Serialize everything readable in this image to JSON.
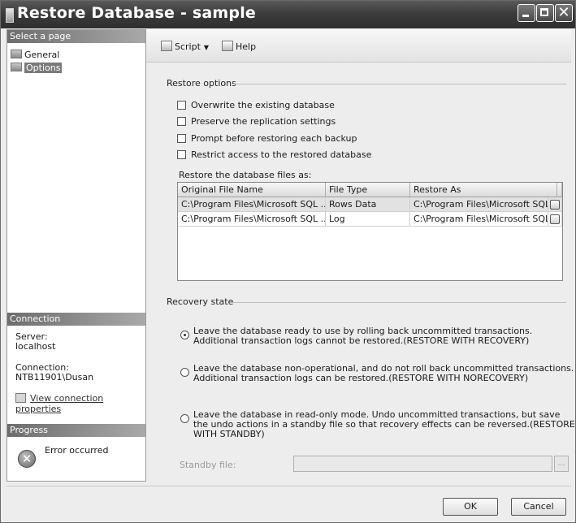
{
  "window": {
    "title": "Restore Database - sample"
  },
  "left": {
    "select_page_header": "Select a page",
    "pages": [
      {
        "label": "General",
        "selected": false
      },
      {
        "label": "Options",
        "selected": true
      }
    ],
    "connection_header": "Connection",
    "server_label": "Server:",
    "server_value": "localhost",
    "connection_label": "Connection:",
    "connection_value": "NTB11901\\Dusan",
    "view_props_link": "View connection properties",
    "progress_header": "Progress",
    "progress_status": "Error occurred",
    "error_icon_glyph": "✕"
  },
  "toolbar": {
    "script_label": "Script",
    "script_dropdown": "▼",
    "help_label": "Help"
  },
  "restore_options": {
    "title": "Restore options",
    "checkboxes": [
      {
        "label": "Overwrite the existing database",
        "checked": false
      },
      {
        "label": "Preserve the replication settings",
        "checked": false
      },
      {
        "label": "Prompt before restoring each backup",
        "checked": false
      },
      {
        "label": "Restrict access to the restored database",
        "checked": false
      }
    ],
    "files_label": "Restore the database files as:",
    "columns": [
      "Original File Name",
      "File Type",
      "Restore As"
    ],
    "rows": [
      {
        "original": "C:\\Program Files\\Microsoft SQL ...",
        "type": "Rows Data",
        "restore_as": "C:\\Program Files\\Microsoft SQL ..."
      },
      {
        "original": "C:\\Program Files\\Microsoft SQL ...",
        "type": "Log",
        "restore_as": "C:\\Program Files\\Microsoft SQL ..."
      }
    ]
  },
  "recovery_state": {
    "title": "Recovery state",
    "options": [
      {
        "text": "Leave the database ready to use by rolling back uncommitted transactions. Additional transaction logs cannot be restored.(RESTORE WITH RECOVERY)",
        "selected": true
      },
      {
        "text": "Leave the database non-operational, and do not roll back uncommitted transactions. Additional transaction logs can be restored.(RESTORE WITH NORECOVERY)",
        "selected": false
      },
      {
        "text": "Leave the database in read-only mode. Undo uncommitted transactions, but save the undo actions in a standby file so that recovery effects can be reversed.(RESTORE WITH STANDBY)",
        "selected": false
      }
    ],
    "standby_label": "Standby file:",
    "standby_value": "",
    "browse_label": "..."
  },
  "footer": {
    "ok_label": "OK",
    "cancel_label": "Cancel"
  },
  "colors": {
    "title_bar": "#3c3c3c",
    "section_header": "#6d6d6d",
    "selected_row": "#e2e2e2"
  },
  "icons": {
    "title": "window-app-icon",
    "minimize": "minimize-icon",
    "maximize": "maximize-icon",
    "close": "close-icon",
    "script": "script-icon",
    "help": "help-icon",
    "page": "page-icon",
    "connection": "connection-properties-icon",
    "error": "error-icon"
  }
}
